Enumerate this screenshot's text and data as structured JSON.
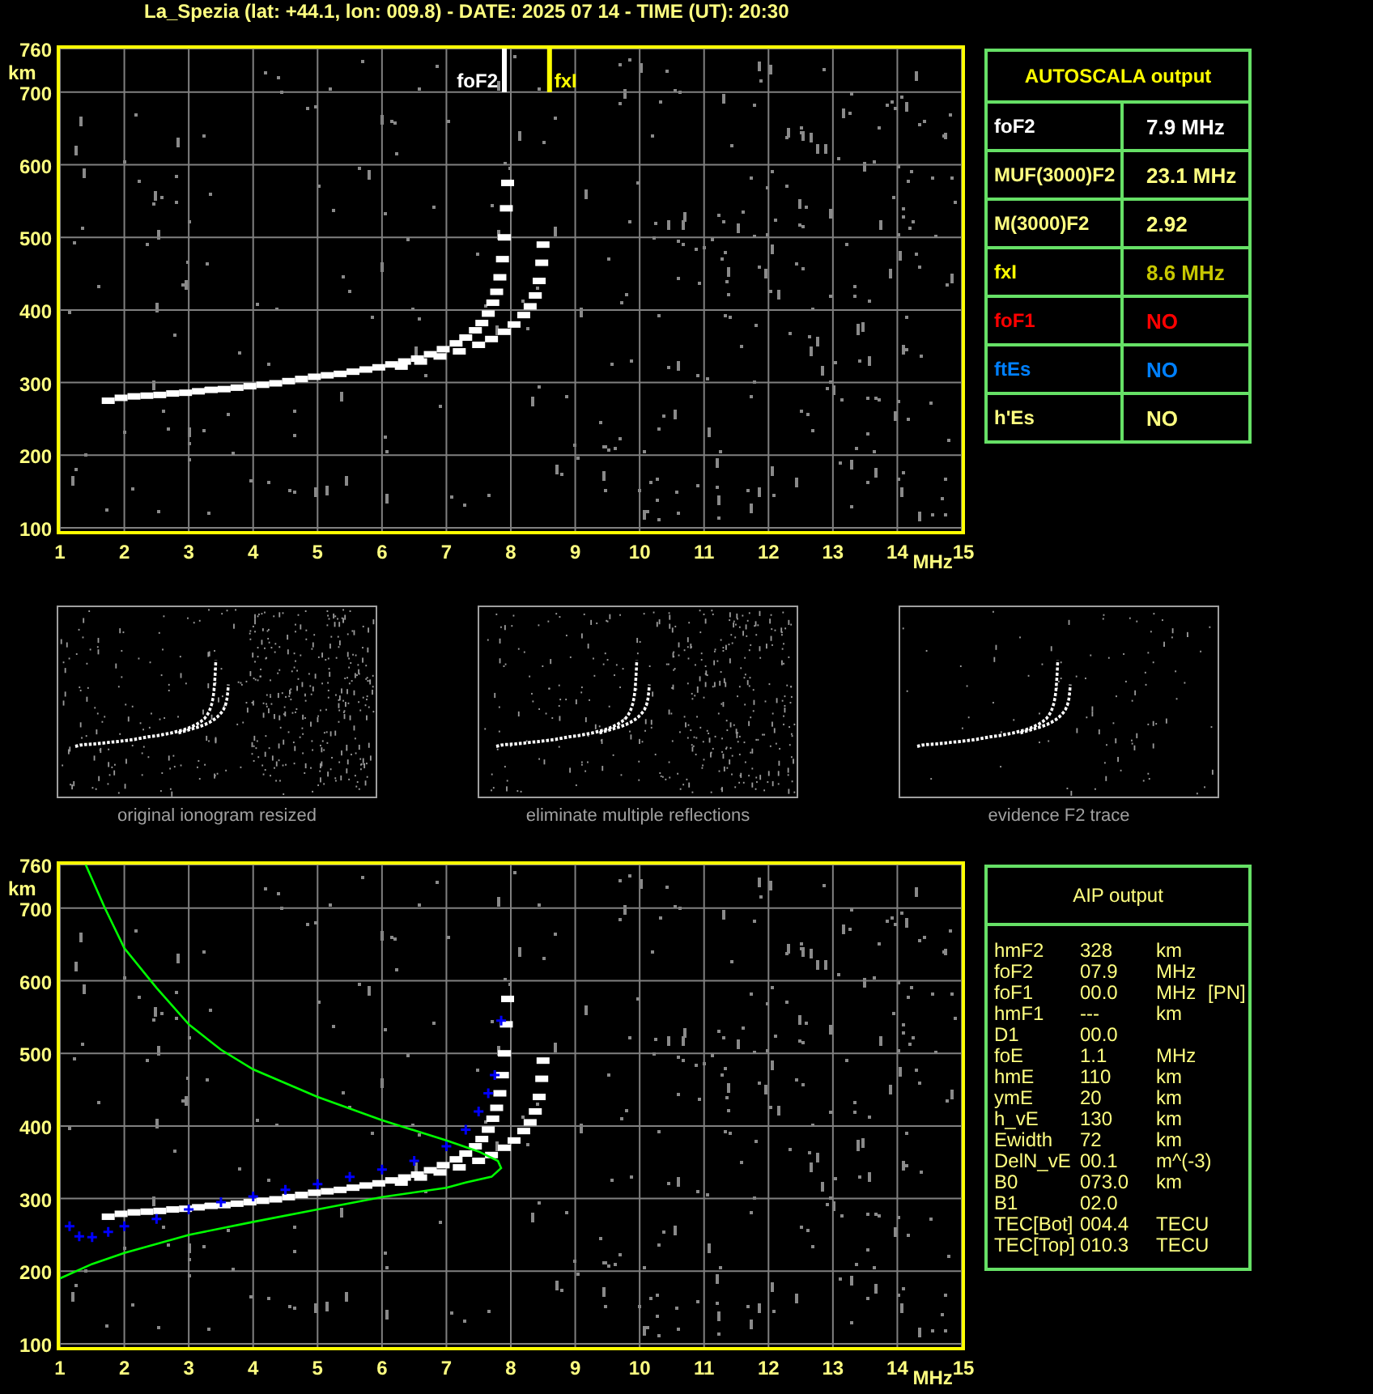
{
  "title": "La_Spezia (lat: +44.1, lon: 009.8) - DATE: 2025 07 14 - TIME (UT): 20:30",
  "ionogram": {
    "chart_data": {
      "type": "scatter",
      "xlabel": "MHz",
      "ylabel": "km",
      "xlim": [
        1,
        15
      ],
      "ylim": [
        100,
        760
      ],
      "grid": true,
      "xticks": [
        1,
        2,
        3,
        4,
        5,
        6,
        7,
        8,
        9,
        10,
        11,
        12,
        13,
        14,
        15
      ],
      "yticks": [
        100,
        200,
        300,
        400,
        500,
        600,
        700,
        760
      ],
      "series": [
        {
          "type": "scatter",
          "marker": "square",
          "color": "#ffffff",
          "x": [
            1.75,
            1.95,
            2.15,
            2.35,
            2.55,
            2.75,
            2.95,
            3.15,
            3.35,
            3.55,
            3.75,
            3.95,
            4.15,
            4.35,
            4.55,
            4.75,
            4.95,
            5.15,
            5.35,
            5.55,
            5.75,
            5.95,
            6.15,
            6.35,
            6.55,
            6.75,
            6.95,
            7.15,
            7.3,
            7.45,
            7.55,
            7.65,
            7.72,
            7.78,
            7.83,
            7.87,
            7.9,
            7.93,
            7.95
          ],
          "values": [
            275,
            279,
            281,
            282,
            283,
            285,
            286,
            288,
            290,
            291,
            293,
            295,
            297,
            299,
            302,
            305,
            308,
            310,
            312,
            315,
            318,
            321,
            325,
            329,
            333,
            339,
            346,
            354,
            362,
            372,
            382,
            395,
            410,
            425,
            445,
            470,
            500,
            540,
            575
          ]
        },
        {
          "type": "scatter",
          "marker": "square",
          "color": "#ffffff",
          "x": [
            6.3,
            6.6,
            6.9,
            7.2,
            7.5,
            7.7,
            7.9,
            8.05,
            8.2,
            8.3,
            8.38,
            8.44,
            8.48,
            8.5
          ],
          "values": [
            322,
            329,
            336,
            343,
            352,
            360,
            370,
            380,
            393,
            405,
            420,
            440,
            465,
            490
          ]
        },
        {
          "type": "line",
          "name": "foF2",
          "color": "#ffffff",
          "x": [
            7.9,
            7.9
          ],
          "values": [
            700,
            760
          ]
        },
        {
          "type": "line",
          "name": "fxI",
          "color": "#ffff00",
          "x": [
            8.6,
            8.6
          ],
          "values": [
            700,
            760
          ]
        }
      ]
    }
  },
  "autoscala_output": {
    "kind": "table",
    "title": "AUTOSCALA output",
    "rows": [
      {
        "cells": [
          {
            "text": "foF2",
            "color": "#ffffff"
          },
          {
            "text": "7.9 MHz",
            "color": "#ffffff"
          }
        ]
      },
      {
        "cells": [
          {
            "text": "MUF(3000)F2",
            "color": "#ffff80"
          },
          {
            "text": "23.1 MHz",
            "color": "#ffff80"
          }
        ]
      },
      {
        "cells": [
          {
            "text": "M(3000)F2",
            "color": "#ffff80"
          },
          {
            "text": "2.92",
            "color": "#ffff80"
          }
        ]
      },
      {
        "cells": [
          {
            "text": "fxI",
            "color": "#ffff00"
          },
          {
            "text": "8.6 MHz",
            "color": "#c8c800"
          }
        ]
      },
      {
        "cells": [
          {
            "text": "foF1",
            "color": "#ff0000"
          },
          {
            "text": "NO",
            "color": "#ff0000"
          }
        ]
      },
      {
        "cells": [
          {
            "text": "ftEs",
            "color": "#0080ff"
          },
          {
            "text": "NO",
            "color": "#0080ff"
          }
        ]
      },
      {
        "cells": [
          {
            "text": "h'Es",
            "color": "#ffff80"
          },
          {
            "text": "NO",
            "color": "#ffff80"
          }
        ]
      }
    ]
  },
  "thumbnails": [
    {
      "caption": "original ionogram resized"
    },
    {
      "caption": "eliminate multiple reflections"
    },
    {
      "caption": "evidence F2 trace"
    }
  ],
  "profile_plot": {
    "chart_data": {
      "type": "scatter",
      "xlabel": "MHz",
      "ylabel": "km",
      "xlim": [
        1,
        15
      ],
      "ylim": [
        100,
        760
      ],
      "grid": true,
      "xticks": [
        1,
        2,
        3,
        4,
        5,
        6,
        7,
        8,
        9,
        10,
        11,
        12,
        13,
        14,
        15
      ],
      "yticks": [
        100,
        200,
        300,
        400,
        500,
        600,
        700,
        760
      ],
      "series": [
        {
          "type": "scatter",
          "marker": "square",
          "color": "#ffffff",
          "x": [
            1.75,
            1.95,
            2.15,
            2.35,
            2.55,
            2.75,
            2.95,
            3.15,
            3.35,
            3.55,
            3.75,
            3.95,
            4.15,
            4.35,
            4.55,
            4.75,
            4.95,
            5.15,
            5.35,
            5.55,
            5.75,
            5.95,
            6.15,
            6.35,
            6.55,
            6.75,
            6.95,
            7.15,
            7.3,
            7.45,
            7.55,
            7.65,
            7.72,
            7.78,
            7.83,
            7.87,
            7.9,
            7.93,
            7.95
          ],
          "values": [
            275,
            279,
            281,
            282,
            283,
            285,
            286,
            288,
            290,
            291,
            293,
            295,
            297,
            299,
            302,
            305,
            308,
            310,
            312,
            315,
            318,
            321,
            325,
            329,
            333,
            339,
            346,
            354,
            362,
            372,
            382,
            395,
            410,
            425,
            445,
            470,
            500,
            540,
            575
          ]
        },
        {
          "type": "scatter",
          "marker": "square",
          "color": "#ffffff",
          "x": [
            6.3,
            6.6,
            6.9,
            7.2,
            7.5,
            7.7,
            7.9,
            8.05,
            8.2,
            8.3,
            8.38,
            8.44,
            8.48,
            8.5
          ],
          "values": [
            322,
            329,
            336,
            343,
            352,
            360,
            370,
            380,
            393,
            405,
            420,
            440,
            465,
            490
          ]
        },
        {
          "type": "scatter",
          "marker": "plus",
          "color": "#0000ff",
          "x": [
            1.15,
            1.3,
            1.5,
            1.75,
            2,
            2.5,
            3,
            3.5,
            4,
            4.5,
            5,
            5.5,
            6,
            6.5,
            7,
            7.3,
            7.5,
            7.65,
            7.75,
            7.85
          ],
          "values": [
            262,
            248,
            247,
            254,
            262,
            272,
            285,
            295,
            303,
            312,
            320,
            330,
            340,
            352,
            372,
            395,
            420,
            445,
            470,
            545
          ]
        },
        {
          "type": "line",
          "color": "#00ff00",
          "x": [
            1.4,
            1.7,
            2,
            2.5,
            3,
            3.5,
            4,
            5,
            6,
            7,
            7.5,
            7.8,
            7.85,
            7.7,
            7.3,
            7,
            6,
            5,
            4,
            3,
            2,
            1.5,
            1
          ],
          "values": [
            760,
            700,
            645,
            590,
            540,
            505,
            478,
            440,
            408,
            380,
            365,
            352,
            342,
            330,
            322,
            315,
            302,
            285,
            268,
            250,
            225,
            210,
            190
          ]
        }
      ]
    }
  },
  "aip_output": {
    "kind": "list",
    "title": "AIP output",
    "rows": [
      {
        "name": "hmF2",
        "value": "328",
        "unit": "km"
      },
      {
        "name": "foF2",
        "value": "07.9",
        "unit": "MHz"
      },
      {
        "name": "foF1",
        "value": "00.0",
        "unit": "MHz",
        "note": "[PN]"
      },
      {
        "name": "hmF1",
        "value": "---",
        "unit": "km"
      },
      {
        "name": "D1",
        "value": "00.0"
      },
      {
        "name": "foE",
        "value": "1.1",
        "unit": "MHz"
      },
      {
        "name": "hmE",
        "value": "110",
        "unit": "km"
      },
      {
        "name": "ymE",
        "value": "20",
        "unit": "km"
      },
      {
        "name": "h_vE",
        "value": "130",
        "unit": "km"
      },
      {
        "name": "Ewidth",
        "value": "72",
        "unit": "km"
      },
      {
        "name": "DelN_vE",
        "value": "00.1",
        "unit": "m^(-3)"
      },
      {
        "name": "B0",
        "value": "073.0",
        "unit": "km"
      },
      {
        "name": "B1",
        "value": "02.0"
      },
      {
        "name": "TEC[Bot]",
        "value": "004.4",
        "unit": "TECU"
      },
      {
        "name": "TEC[Top]",
        "value": "010.3",
        "unit": "TECU"
      }
    ]
  }
}
